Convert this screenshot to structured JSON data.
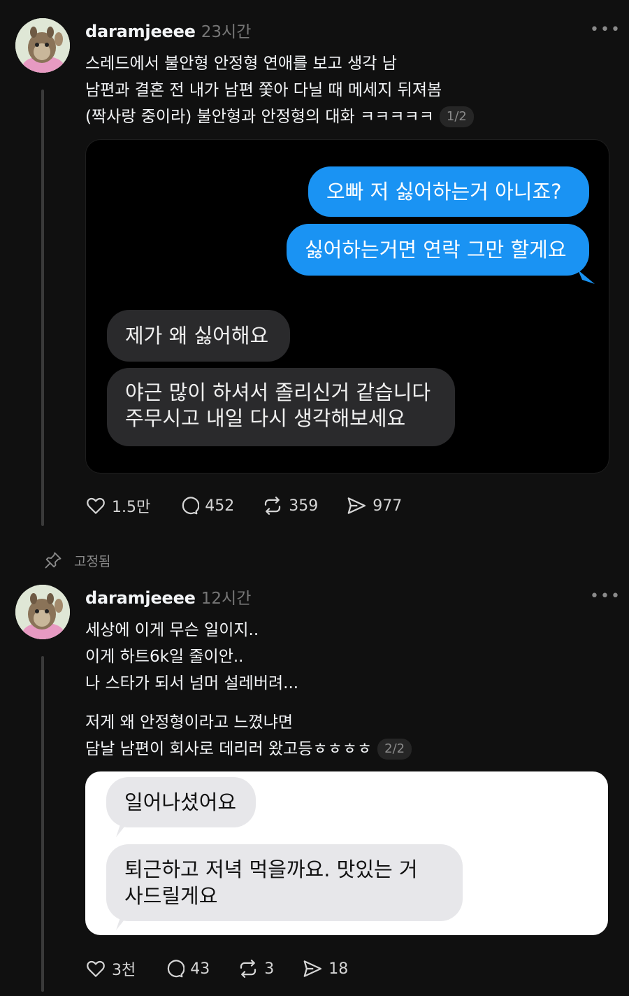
{
  "post1": {
    "username": "daramjeeee",
    "time": "23시간",
    "lines": [
      "스레드에서 불안형 안정형 연애를 보고 생각 남",
      "남편과 결혼 전  내가 남편 쫓아 다닐 때 메세지 뒤져봄",
      "(짝사랑 중이라) 불안형과 안정형의 대화 ㅋㅋㅋㅋㅋ"
    ],
    "pager": "1/2",
    "chat": {
      "sent": [
        "오빠 저 싫어하는거 아니죠?",
        "싫어하는거면 연락 그만 할게요"
      ],
      "received1": "제가 왜 싫어해요",
      "received2": [
        "야근 많이 하셔서 졸리신거 같습니다",
        "주무시고 내일 다시 생각해보세요"
      ]
    },
    "stats": {
      "likes": "1.5만",
      "comments": "452",
      "reposts": "359",
      "shares": "977"
    }
  },
  "pinned_label": "고정됨",
  "post2": {
    "username": "daramjeeee",
    "time": "12시간",
    "lines": [
      "세상에 이게 무슨 일이지..",
      "이게 하트6k일 줄이안..",
      "나 스타가 되서 넘머 설레버려..."
    ],
    "lines2": [
      "저게 왜 안정형이라고 느꼈냐면",
      "담날 남편이 회사로 데리러 왔고등ㅎㅎㅎㅎ"
    ],
    "pager": "2/2",
    "chat": {
      "received1": "일어나셨어요",
      "received2": [
        "퇴근하고 저녁 먹을까요. 맛있는 거",
        "사드릴게요"
      ]
    },
    "stats": {
      "likes": "3천",
      "comments": "43",
      "reposts": "3",
      "shares": "18"
    }
  },
  "icons": [
    "more-icon",
    "heart-icon",
    "comment-icon",
    "repost-icon",
    "share-icon",
    "pin-icon"
  ],
  "colors": {
    "background": "#101010",
    "bubble_blue": "#1a93f3",
    "bubble_dark": "#2a2a2c",
    "bubble_light": "#e7e7ea"
  }
}
